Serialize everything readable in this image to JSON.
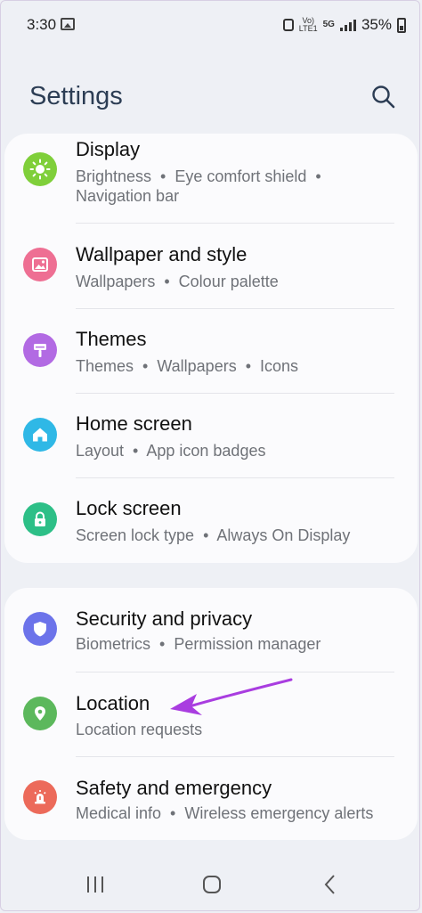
{
  "status_bar": {
    "time": "3:30",
    "network_volte": "Vo)\nLTE1",
    "network_5g": "5G",
    "battery_pct": "35%"
  },
  "header": {
    "title": "Settings",
    "search_icon": "search-icon"
  },
  "groups": [
    {
      "items": [
        {
          "id": "display",
          "title": "Display",
          "subtitle": "Brightness  •  Eye comfort shield  •\nNavigation bar",
          "icon": "sun-icon",
          "color": "#7fcf3a"
        },
        {
          "id": "wallpaper",
          "title": "Wallpaper and style",
          "subtitle": "Wallpapers  •  Colour palette",
          "icon": "image-icon",
          "color": "#ee6f93"
        },
        {
          "id": "themes",
          "title": "Themes",
          "subtitle": "Themes  •  Wallpapers  •  Icons",
          "icon": "paint-brush-icon",
          "color": "#b26ae3"
        },
        {
          "id": "home",
          "title": "Home screen",
          "subtitle": "Layout  •  App icon badges",
          "icon": "home-icon",
          "color": "#2fb8e6"
        },
        {
          "id": "lock",
          "title": "Lock screen",
          "subtitle": "Screen lock type  •  Always On Display",
          "icon": "lock-icon",
          "color": "#2dbf87"
        }
      ]
    },
    {
      "items": [
        {
          "id": "security",
          "title": "Security and privacy",
          "subtitle": "Biometrics  •  Permission manager",
          "icon": "shield-icon",
          "color": "#6c73ea"
        },
        {
          "id": "location",
          "title": "Location",
          "subtitle": "Location requests",
          "icon": "location-pin-icon",
          "color": "#5cb85c"
        },
        {
          "id": "safety",
          "title": "Safety and emergency",
          "subtitle": "Medical info  •  Wireless emergency alerts",
          "icon": "emergency-icon",
          "color": "#ec6a5a"
        }
      ]
    }
  ],
  "annotation": {
    "color": "#a93de0",
    "icon": "arrow-pointer-icon"
  },
  "nav_bar": {
    "recents": "recents-icon",
    "home": "home-button-icon",
    "back": "back-icon"
  }
}
